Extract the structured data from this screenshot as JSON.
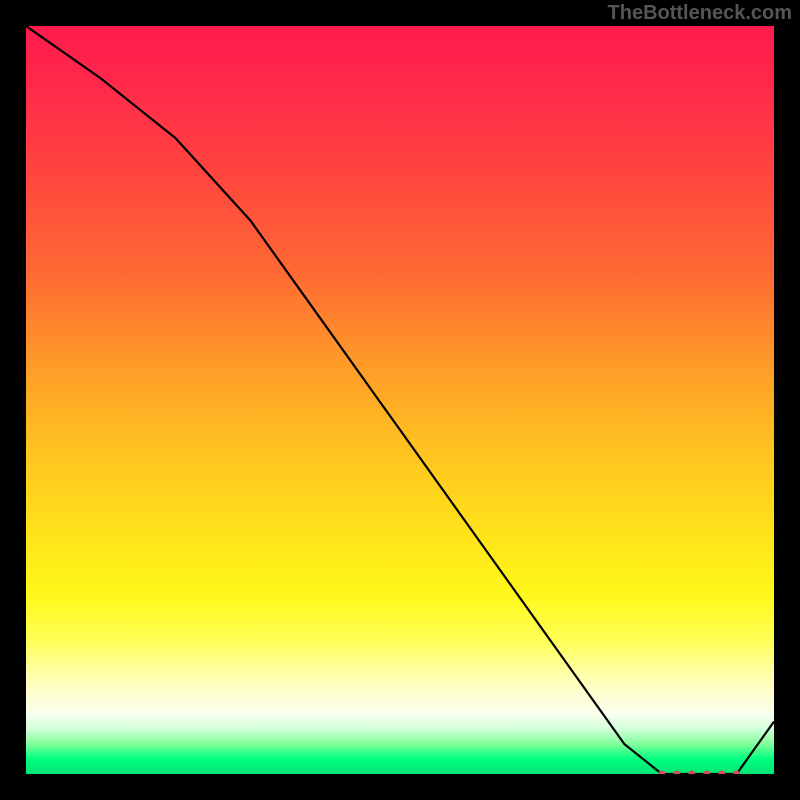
{
  "watermark": "TheBottleneck.com",
  "chart_data": {
    "type": "line",
    "title": "",
    "xlabel": "",
    "ylabel": "",
    "xlim": [
      0,
      100
    ],
    "ylim": [
      0,
      100
    ],
    "x": [
      0,
      10,
      20,
      30,
      40,
      50,
      60,
      70,
      80,
      85,
      90,
      95,
      100
    ],
    "values": [
      100,
      93,
      85,
      74,
      60,
      46,
      32,
      18,
      4,
      0,
      0,
      0,
      7
    ],
    "markers_x": [
      85,
      87,
      89,
      91,
      93,
      95
    ],
    "markers_y": [
      0,
      0,
      0,
      0,
      0,
      0
    ],
    "gradient_colors": {
      "top": "#ff1a4d",
      "mid_high": "#ff9e28",
      "mid": "#ffe31a",
      "low": "#ffffc0",
      "bottom": "#00e676"
    }
  }
}
